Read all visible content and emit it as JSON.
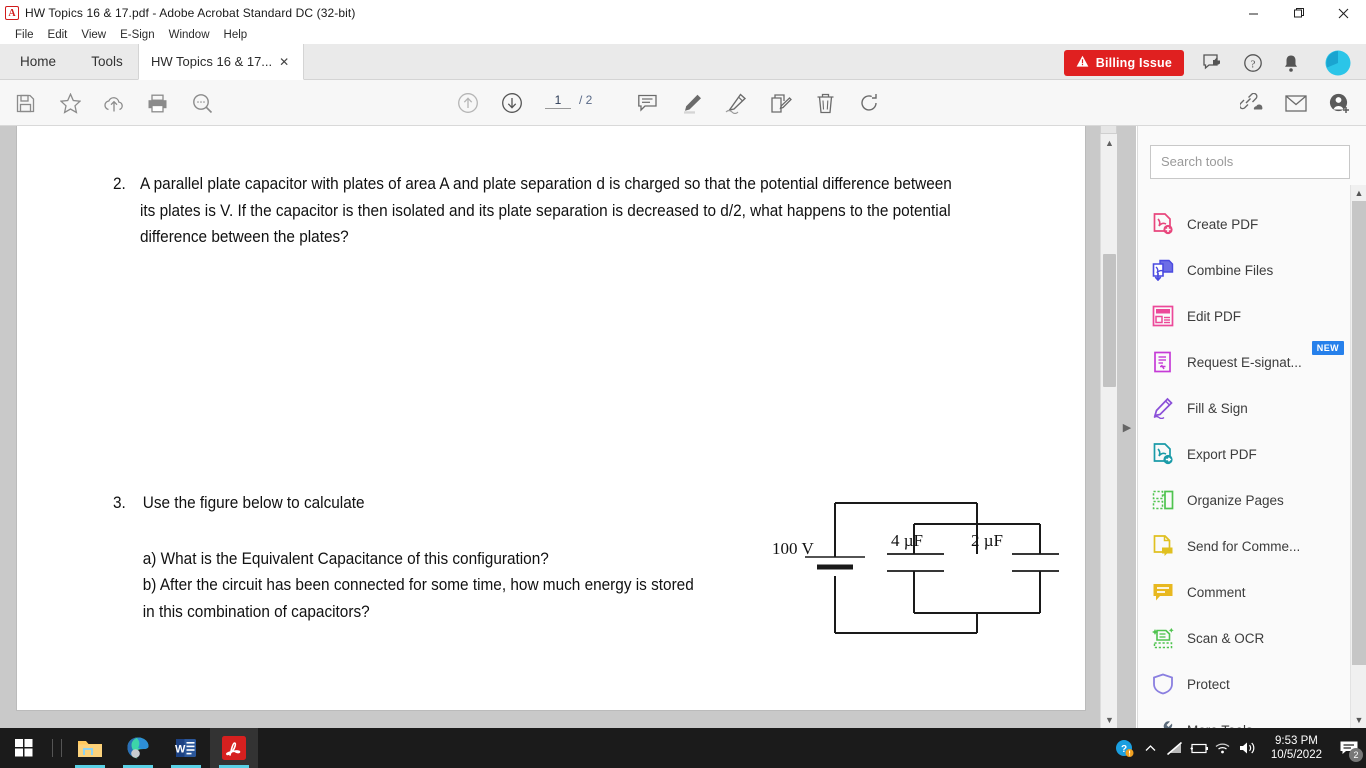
{
  "window": {
    "title": "HW Topics 16 & 17.pdf - Adobe Acrobat Standard DC (32-bit)",
    "app_icon": "acrobat-icon",
    "minimize": "—",
    "maximize": "❐",
    "close": "✕"
  },
  "menubar": {
    "items": [
      "File",
      "Edit",
      "View",
      "E-Sign",
      "Window",
      "Help"
    ]
  },
  "tabstrip": {
    "home": "Home",
    "tools": "Tools",
    "document_tab": "HW Topics 16 & 17...",
    "close_tab": "✕",
    "billing": {
      "label": "Billing Issue",
      "icon": "warning-triangle-icon",
      "color": "#e02020"
    },
    "icons": [
      "feedback-icon",
      "help-icon",
      "bell-icon",
      "avatar-icon"
    ]
  },
  "toolbar": {
    "icons": [
      "save-icon",
      "star-icon",
      "upload-cloud-icon",
      "print-icon",
      "zoom-search-icon",
      "previous-page-icon",
      "next-page-icon",
      "comment-icon",
      "highlight-icon",
      "draw-icon",
      "stamp-edit-icon",
      "delete-icon",
      "rotate-icon",
      "share-link-icon",
      "email-icon",
      "add-person-icon"
    ],
    "page_current": "1",
    "page_total": "/ 2"
  },
  "document": {
    "q2": {
      "number": "2.",
      "text": "A parallel plate capacitor with plates of area A and plate separation d is charged so that the potential difference between its plates is V. If the capacitor is then isolated and its plate separation is decreased to d/2, what happens to the potential difference between the plates?"
    },
    "q3": {
      "number": "3.",
      "heading": "Use the figure below to calculate",
      "part_a": "a) What is the Equivalent Capacitance of this configuration?",
      "part_b": "b) After the circuit has been connected for some time, how much energy is stored in this combination of capacitors?"
    },
    "figure": {
      "name": "capacitor-circuit-diagram",
      "battery_label": "100 V",
      "capacitor_1": "4 μF",
      "capacitor_2": "2 μF"
    }
  },
  "sidebar": {
    "search_placeholder": "Search tools",
    "tools": [
      {
        "label": "Create PDF",
        "icon": "create-pdf-icon",
        "color": "#e8467c",
        "badge": null
      },
      {
        "label": "Combine Files",
        "icon": "combine-files-icon",
        "color": "#4a4ae0",
        "badge": null
      },
      {
        "label": "Edit PDF",
        "icon": "edit-pdf-icon",
        "color": "#ec4899",
        "badge": null
      },
      {
        "label": "Request E-signat...",
        "icon": "request-esignature-icon",
        "color": "#c53bd6",
        "badge": "NEW"
      },
      {
        "label": "Fill & Sign",
        "icon": "fill-sign-icon",
        "color": "#8a4fd8",
        "badge": null
      },
      {
        "label": "Export PDF",
        "icon": "export-pdf-icon",
        "color": "#1a9ba8",
        "badge": null
      },
      {
        "label": "Organize Pages",
        "icon": "organize-pages-icon",
        "color": "#4fc34f",
        "badge": null
      },
      {
        "label": "Send for Comme...",
        "icon": "send-for-comments-icon",
        "color": "#e0c020",
        "badge": null
      },
      {
        "label": "Comment",
        "icon": "comment-tool-icon",
        "color": "#e8b820",
        "badge": null
      },
      {
        "label": "Scan & OCR",
        "icon": "scan-ocr-icon",
        "color": "#4fc34f",
        "badge": null
      },
      {
        "label": "Protect",
        "icon": "protect-shield-icon",
        "color": "#8a7fe0",
        "badge": null
      },
      {
        "label": "More Tools",
        "icon": "more-tools-icon",
        "color": "#5a6a7a",
        "badge": null
      }
    ]
  },
  "taskbar": {
    "start": "windows-start-icon",
    "apps": [
      "file-explorer-icon",
      "edge-icon",
      "word-icon",
      "acrobat-icon"
    ],
    "tray_icons": [
      "help-question-icon",
      "show-hidden-icons-chevron",
      "network-disconnected-icon",
      "battery-icon",
      "wifi-icon",
      "volume-icon"
    ],
    "time": "9:53 PM",
    "date": "10/5/2022",
    "notification_count": "2"
  }
}
